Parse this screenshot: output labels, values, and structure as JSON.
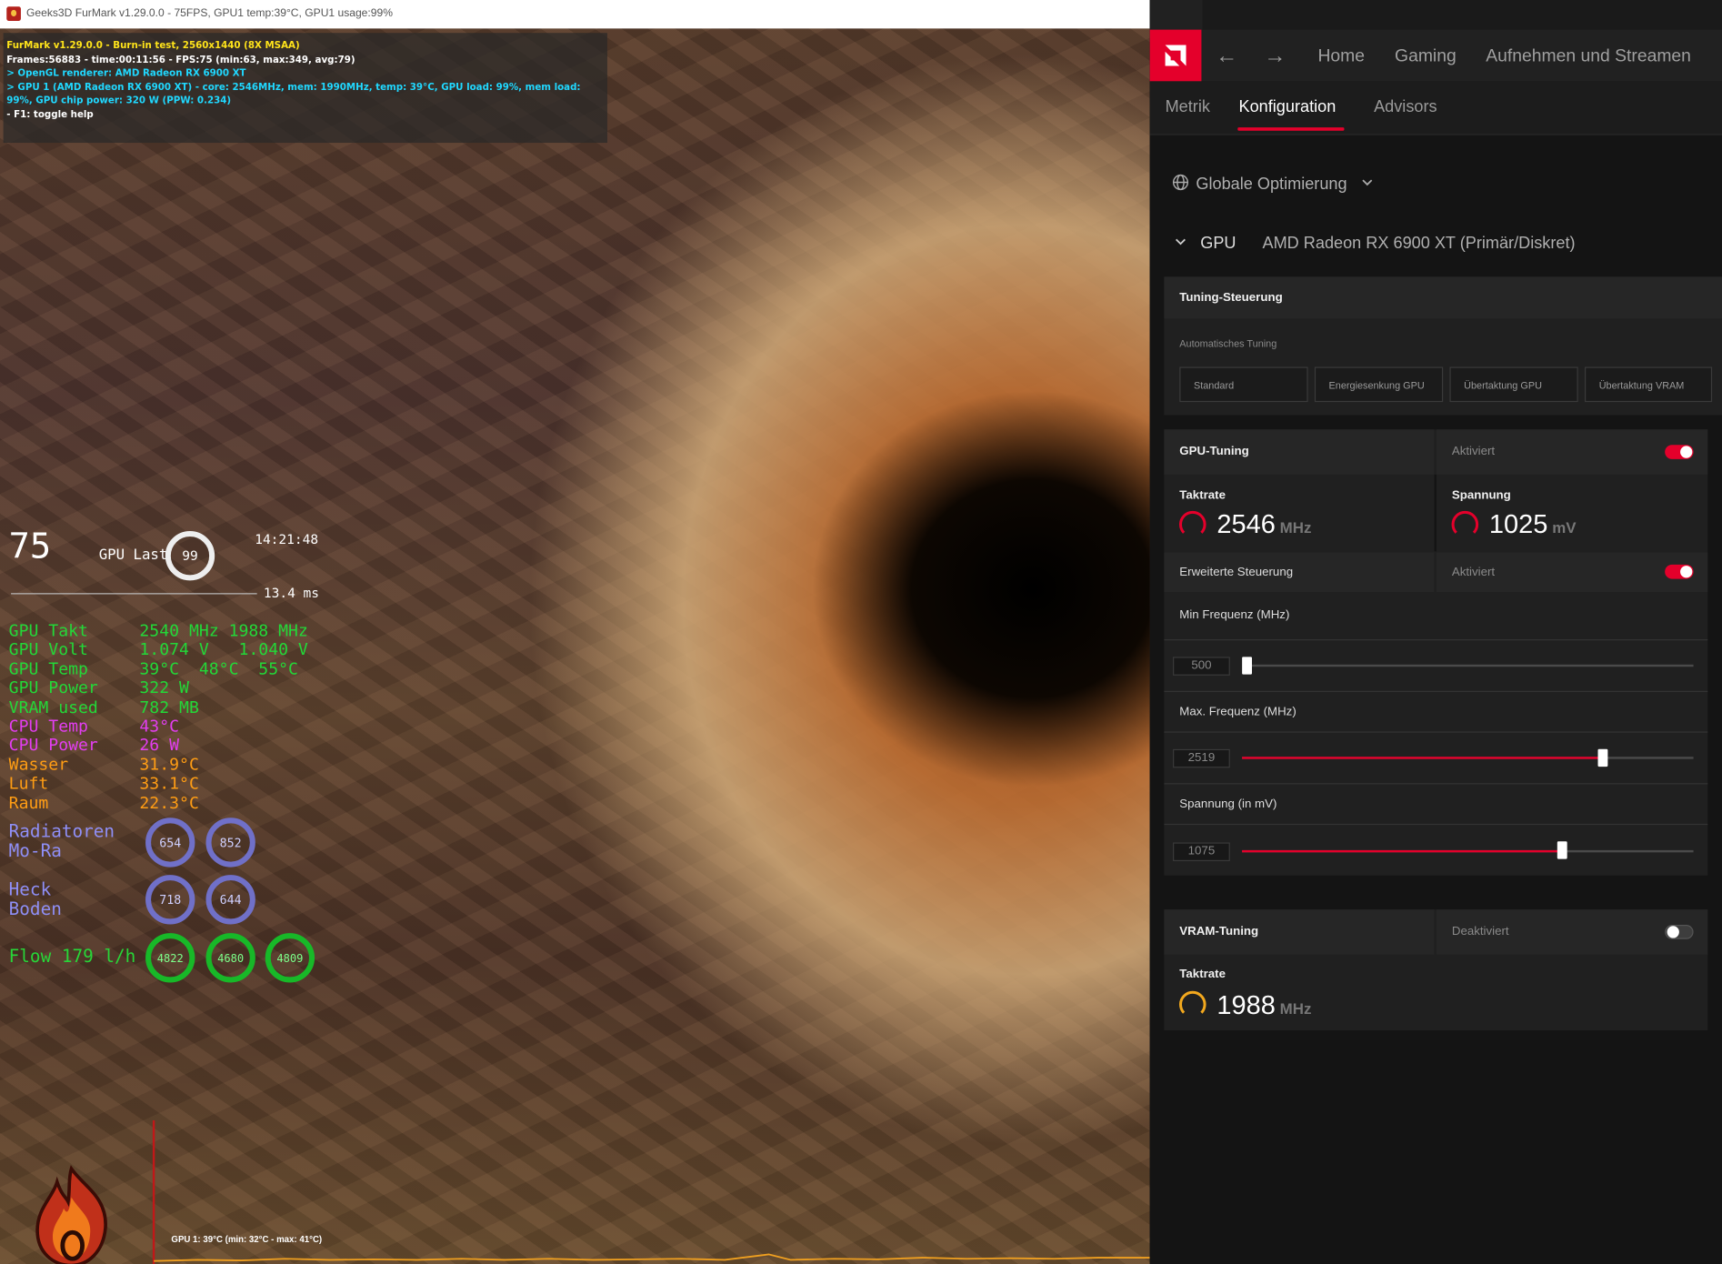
{
  "furmark": {
    "window_title": "Geeks3D FurMark v1.29.0.0 - 75FPS, GPU1 temp:39°C, GPU1 usage:99%",
    "info_lines": [
      "FurMark v1.29.0.0 - Burn-in test, 2560x1440 (8X MSAA)",
      "Frames:56883 - time:00:11:56 - FPS:75 (min:63, max:349, avg:79)",
      "> OpenGL renderer: AMD Radeon RX 6900 XT",
      "> GPU 1 (AMD Radeon RX 6900 XT) - core: 2546MHz, mem: 1990MHz, temp: 39°C, GPU load: 99%, mem load: 99%, GPU chip power: 320 W (PPW: 0.234)",
      "- F1: toggle help"
    ],
    "graph_label": "GPU 1: 39°C (min: 32°C - max: 41°C)"
  },
  "osd": {
    "fps": "75",
    "gpu_last_label": "GPU Last",
    "gpu_last_value": "99",
    "time": "14:21:48",
    "frametime": "13.4 ms",
    "rows": [
      {
        "label": "GPU Takt",
        "values": "2540 MHz 1988 MHz",
        "color": "#23d838"
      },
      {
        "label": "GPU Volt",
        "values": "1.074 V   1.040 V",
        "color": "#23d838"
      },
      {
        "label": "GPU Temp",
        "values": "39°C  48°C  55°C",
        "color": "#23d838"
      },
      {
        "label": "GPU Power",
        "values": "322 W",
        "color": "#23d838"
      },
      {
        "label": "VRAM used",
        "values": "782 MB",
        "color": "#23d838"
      },
      {
        "label": "CPU Temp",
        "values": "43°C",
        "color": "#e23ef0"
      },
      {
        "label": "CPU Power",
        "values": "26 W",
        "color": "#e23ef0"
      },
      {
        "label": "Wasser",
        "values": "31.9°C",
        "color": "#ff9d14"
      },
      {
        "label": "Luft",
        "values": "33.1°C",
        "color": "#ff9d14"
      },
      {
        "label": "Raum",
        "values": "22.3°C",
        "color": "#ff9d14"
      }
    ],
    "radiatoren_l1": "Radiatoren",
    "radiatoren_l2": "Mo-Ra",
    "heck_l1": "Heck",
    "heck_l2": "Boden",
    "flow": "Flow 179 l/h",
    "rings": {
      "rad1": "654",
      "rad2": "852",
      "heck1": "718",
      "heck2": "644",
      "flow1": "4822",
      "flow2": "4680",
      "flow3": "4809"
    }
  },
  "amd": {
    "nav": {
      "home": "Home",
      "gaming": "Gaming",
      "record": "Aufnehmen und Streamen"
    },
    "tabs": {
      "metrik": "Metrik",
      "konfiguration": "Konfiguration",
      "advisors": "Advisors"
    },
    "profile": "Globale Optimierung",
    "gpu_label": "GPU",
    "gpu_name": "AMD Radeon RX 6900 XT (Primär/Diskret)",
    "tuning": {
      "title": "Tuning-Steuerung",
      "auto_label": "Automatisches Tuning",
      "buttons": [
        "Standard",
        "Energiesenkung GPU",
        "Übertaktung GPU",
        "Übertaktung VRAM"
      ]
    },
    "gpu_tuning": {
      "title": "GPU-Tuning",
      "state": "Aktiviert",
      "taktrate_label": "Taktrate",
      "taktrate_value": "2546",
      "taktrate_unit": "MHz",
      "spannung_label": "Spannung",
      "spannung_value": "1025",
      "spannung_unit": "mV",
      "advanced_label": "Erweiterte Steuerung",
      "advanced_state": "Aktiviert",
      "min_freq_label": "Min Frequenz (MHz)",
      "min_freq_value": "500",
      "max_freq_label": "Max. Frequenz (MHz)",
      "max_freq_value": "2519",
      "volt_label": "Spannung (in mV)",
      "volt_value": "1075"
    },
    "vram_tuning": {
      "title": "VRAM-Tuning",
      "state": "Deaktiviert",
      "taktrate_label": "Taktrate",
      "taktrate_value": "1988",
      "taktrate_unit": "MHz"
    },
    "colors": {
      "accent": "#e4002b",
      "vram_accent": "#f2a81e"
    }
  }
}
